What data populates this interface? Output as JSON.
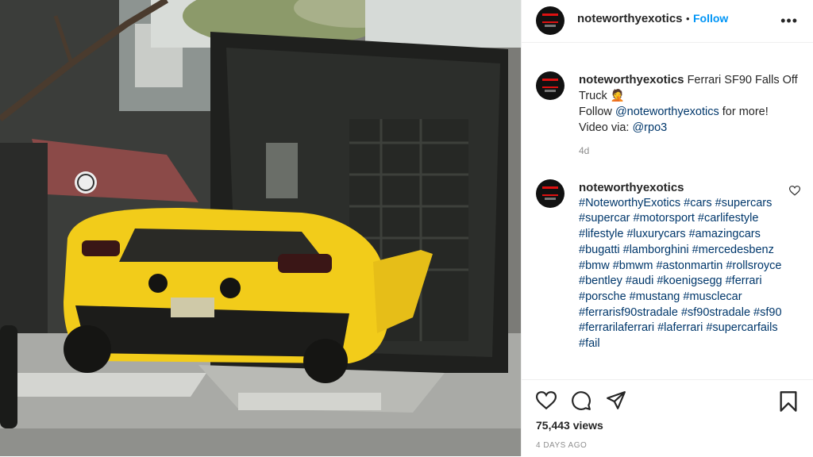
{
  "post": {
    "author": "noteworthyexotics",
    "follow_label": "Follow",
    "separator": "•",
    "more_label": "•••",
    "caption_text": "Ferrari SF90 Falls Off Truck",
    "caption_emoji": "🤦",
    "caption_follow_prefix": "Follow ",
    "caption_mention": "@noteworthyexotics",
    "caption_follow_suffix": " for more!",
    "caption_via_prefix": "Video via: ",
    "caption_via_mention": "@rpo3",
    "caption_age": "4d",
    "hashtags": "#NoteworthyExotics #cars #supercars #supercar #motorsport #carlifestyle #lifestyle #luxurycars #amazingcars #bugatti #lamborghini #mercedesbenz #bmw #bmwm #astonmartin #rollsroyce #bentley #audi #koenigsegg #ferrari #porsche #mustang #musclecar #ferrarisf90stradale #sf90stradale #sf90 #ferrarilaferrari #laferrari #supercarfails #fail",
    "views": "75,443 views",
    "date": "4 DAYS AGO"
  },
  "icons": {
    "like": "heart-icon",
    "comment": "comment-icon",
    "share": "share-icon",
    "save": "bookmark-icon",
    "more": "more-options-icon"
  },
  "colors": {
    "follow": "#0095f6",
    "link": "#00376b",
    "muted": "#8e8e8e",
    "car": "#f2cc1a"
  }
}
